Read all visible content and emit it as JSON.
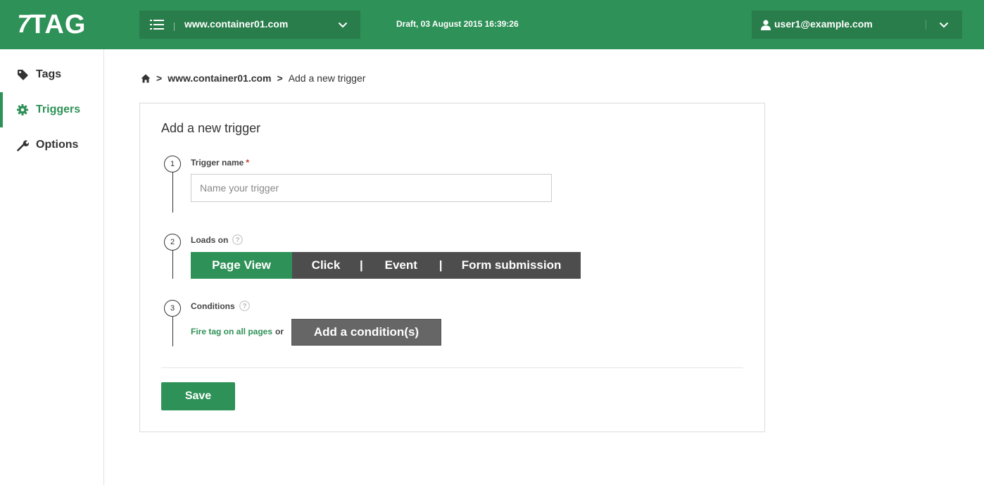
{
  "app": {
    "logo_mark": "7",
    "logo_text": "TAG"
  },
  "header": {
    "container_select": {
      "icon": "list-icon",
      "value": "www.container01.com",
      "chevron": "chevron-down-icon"
    },
    "status": "Draft, 03 August 2015 16:39:26",
    "user_select": {
      "icon": "user-icon",
      "value": "user1@example.com",
      "chevron": "chevron-down-icon"
    }
  },
  "sidebar": {
    "items": [
      {
        "label": "Tags",
        "icon": "tag-icon",
        "active": false
      },
      {
        "label": "Triggers",
        "icon": "gear-icon",
        "active": true
      },
      {
        "label": "Options",
        "icon": "wrench-icon",
        "active": false
      }
    ]
  },
  "breadcrumb": {
    "home_icon": "home-icon",
    "separator": ">",
    "items": [
      "www.container01.com",
      "Add a new trigger"
    ]
  },
  "form": {
    "title": "Add a new trigger",
    "steps": [
      {
        "number": "1",
        "label": "Trigger name",
        "required_mark": "*",
        "input": {
          "value": "",
          "placeholder": "Name your trigger"
        }
      },
      {
        "number": "2",
        "label": "Loads on",
        "help_icon": "help-icon",
        "options": [
          "Page View",
          "Click",
          "Event",
          "Form submission"
        ],
        "separator": "|",
        "selected": "Page View"
      },
      {
        "number": "3",
        "label": "Conditions",
        "help_icon": "help-icon",
        "fire_link": "Fire tag on all pages",
        "or_text": "or",
        "add_condition_label": "Add a condition(s)"
      }
    ],
    "save_label": "Save"
  },
  "colors": {
    "brand_green": "#2e9157",
    "brand_green_dark": "#287d4a",
    "segment_dark": "#4d4d4d",
    "button_gray": "#666666"
  }
}
